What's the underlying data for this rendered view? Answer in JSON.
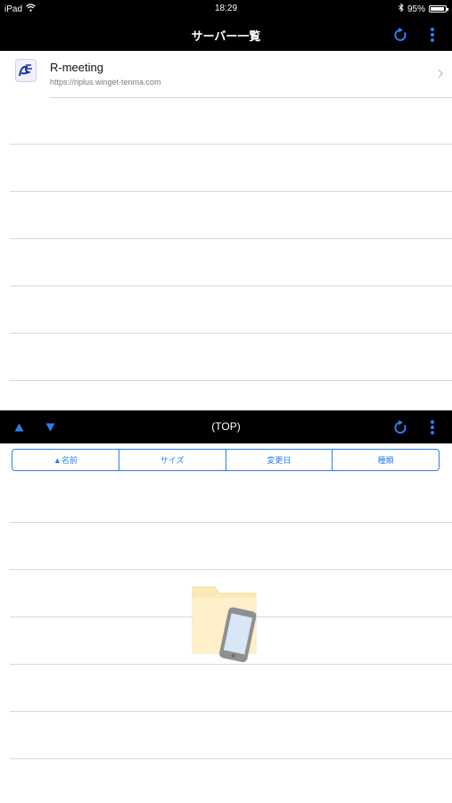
{
  "status_bar": {
    "device": "iPad",
    "time": "18:29",
    "battery": "95%",
    "battery_level": 0.95,
    "icons": [
      "wifi-icon",
      "bluetooth-icon",
      "battery-icon"
    ]
  },
  "nav": {
    "title": "サーバー一覧",
    "icons": [
      "refresh-icon",
      "more-vert-icon"
    ]
  },
  "servers": [
    {
      "name": "R-meeting",
      "url": "https://riplus.winget-tenma.com"
    }
  ],
  "file_browser": {
    "path": "(TOP)",
    "icons": [
      "arrow-up-icon",
      "arrow-down-icon",
      "refresh-icon",
      "more-vert-icon"
    ],
    "sort_columns": [
      "▲名前",
      "サイズ",
      "変更日",
      "種類"
    ]
  },
  "colors": {
    "bar_bg": "#000000",
    "accent": "#2d7ff0",
    "separator": "#d8d8d8",
    "folder": "#fbe9b6",
    "device": "#8f8f8f"
  }
}
